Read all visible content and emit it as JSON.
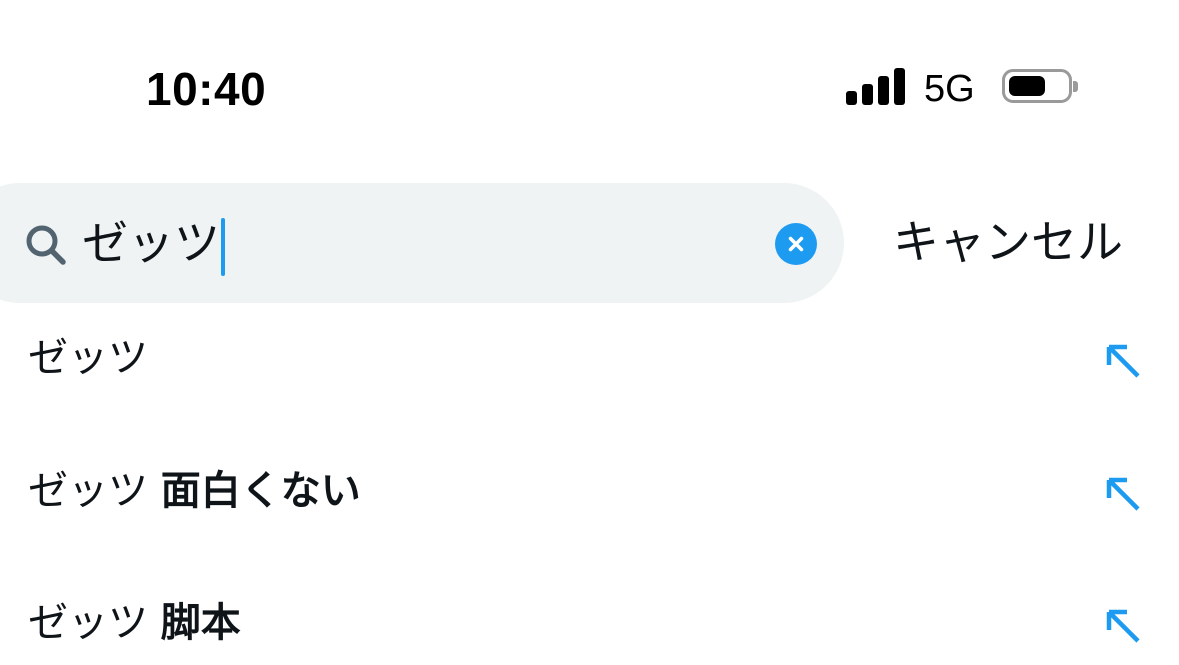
{
  "status_bar": {
    "time": "10:40",
    "network": "5G",
    "battery_level": 0.6
  },
  "search": {
    "query": "ゼッツ",
    "cancel_label": "キャンセル"
  },
  "suggestions": [
    {
      "prefix": "ゼッツ",
      "suffix": ""
    },
    {
      "prefix": "ゼッツ ",
      "suffix": "面白くない"
    },
    {
      "prefix": "ゼッツ ",
      "suffix": "脚本"
    }
  ],
  "colors": {
    "accent": "#1d9bf0",
    "search_bg": "#eff3f4",
    "text": "#0f1419"
  },
  "icons": [
    "signal-icon",
    "battery-icon",
    "search-icon",
    "clear-icon",
    "arrow-up-left-icon"
  ]
}
